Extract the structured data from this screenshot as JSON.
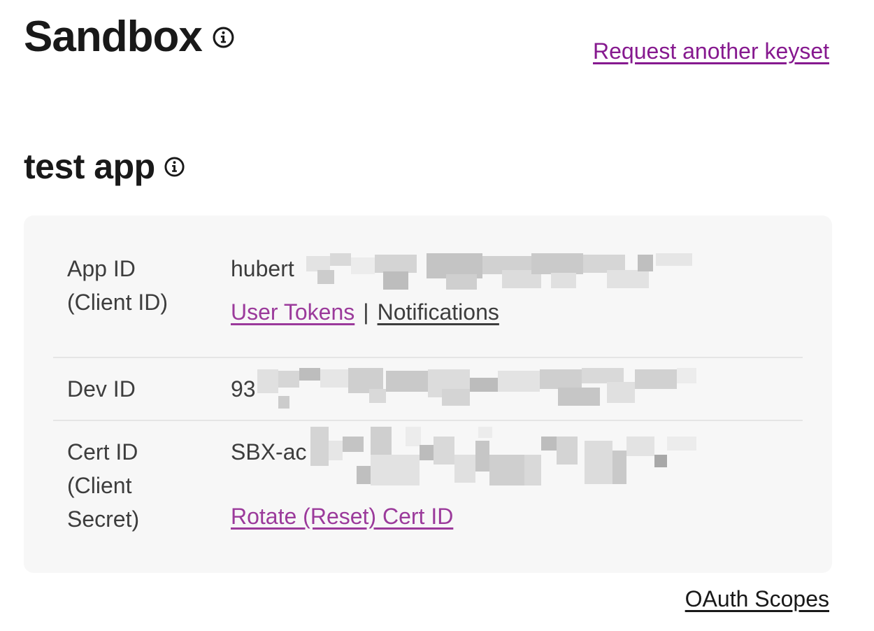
{
  "header": {
    "title": "Sandbox",
    "title_icon": "info-icon",
    "request_link": "Request another keyset"
  },
  "app": {
    "name": "test app",
    "name_icon": "info-icon"
  },
  "keys": {
    "app_id": {
      "label_line1": "App ID",
      "label_line2": "(Client ID)",
      "value": "hubert",
      "links": {
        "user_tokens": "User Tokens",
        "separator": "|",
        "notifications": "Notifications"
      }
    },
    "dev_id": {
      "label": "Dev ID",
      "value": "93"
    },
    "cert_id": {
      "label_line1": "Cert ID",
      "label_line2": "(Client",
      "label_line3": "Secret)",
      "value": "SBX-ac",
      "rotate_link": "Rotate (Reset) Cert ID"
    }
  },
  "footer": {
    "oauth_link": "OAuth Scopes"
  },
  "colors": {
    "accent_purple": "#86198f",
    "link_purple": "#9b3a9b",
    "card_bg": "#f7f7f7",
    "text_dark": "#191919",
    "text_body": "#3d3d3d"
  }
}
